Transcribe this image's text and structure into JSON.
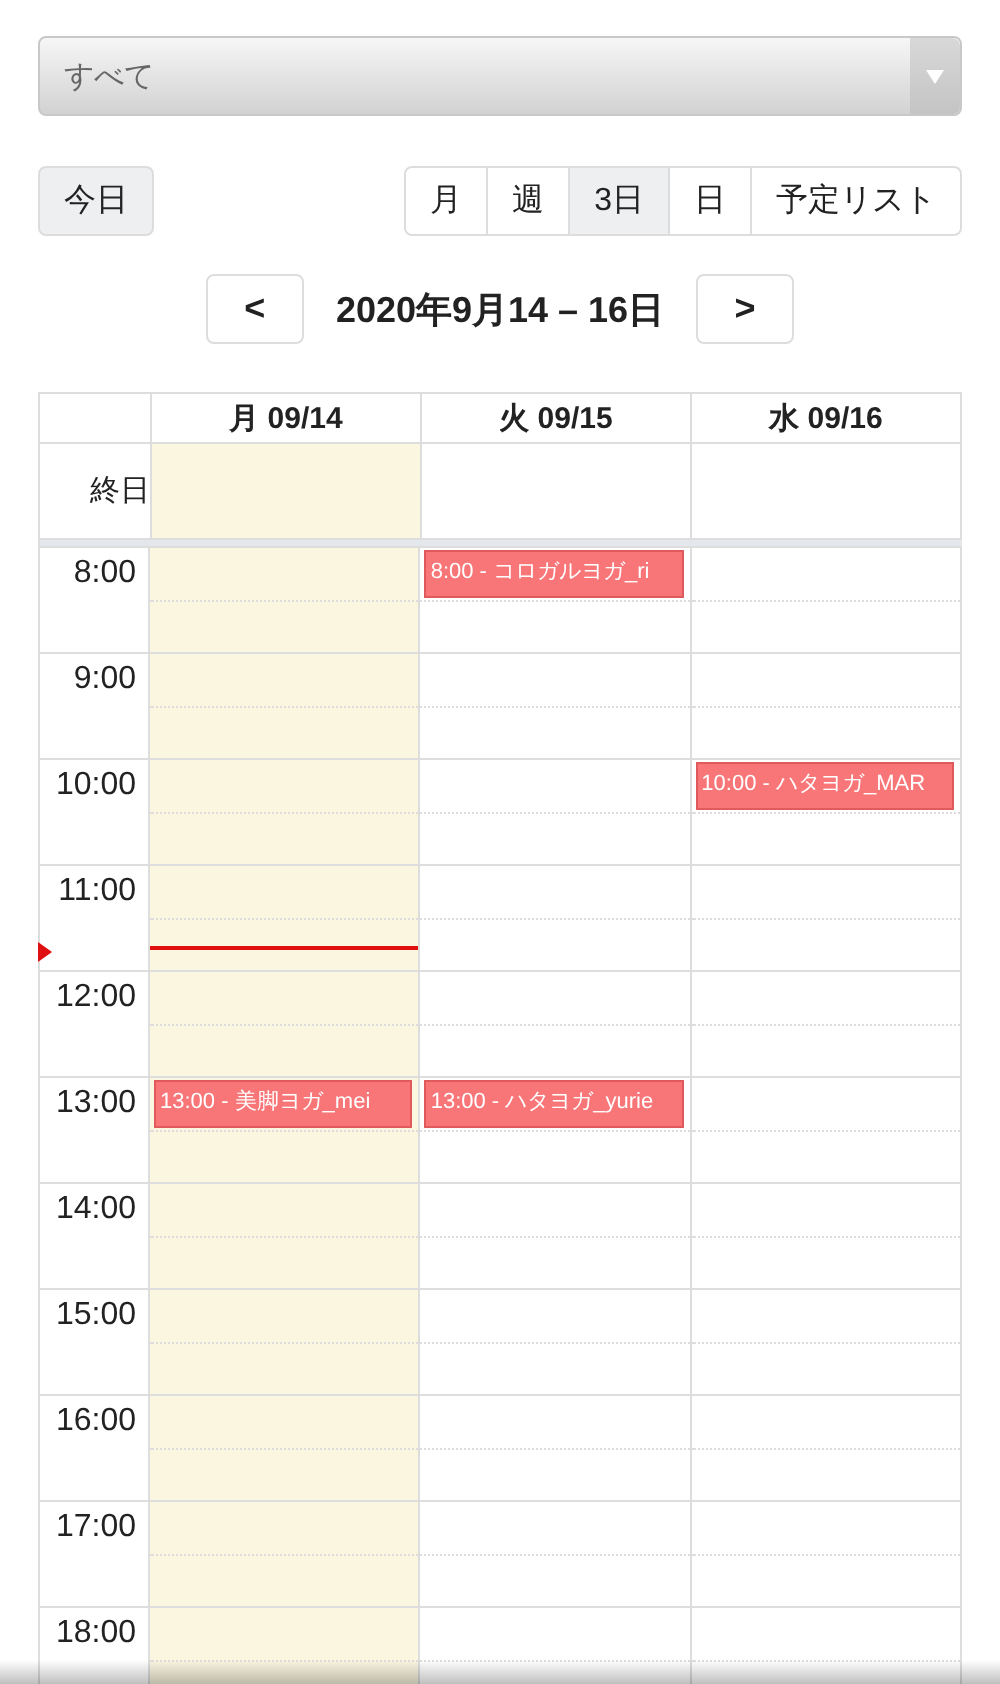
{
  "filter": {
    "value": "すべて"
  },
  "today_button": "今日",
  "views": [
    {
      "label": "月",
      "selected": false
    },
    {
      "label": "週",
      "selected": false
    },
    {
      "label": "3日",
      "selected": true
    },
    {
      "label": "日",
      "selected": false
    },
    {
      "label": "予定リスト",
      "selected": false
    }
  ],
  "nav": {
    "prev": "<",
    "title": "2020年9月14 – 16日",
    "next": ">"
  },
  "days": [
    {
      "label": "月 09/14",
      "today": true
    },
    {
      "label": "火 09/15",
      "today": false
    },
    {
      "label": "水 09/16",
      "today": false
    }
  ],
  "all_day_label": "終日",
  "hours": [
    {
      "label": "8:00",
      "cells": [
        {},
        {
          "event": "8:00 - コロガルヨガ_ri"
        },
        {}
      ]
    },
    {
      "label": "9:00",
      "cells": [
        {},
        {},
        {}
      ]
    },
    {
      "label": "10:00",
      "cells": [
        {},
        {},
        {
          "event": "10:00 - ハタヨガ_MAR"
        }
      ]
    },
    {
      "label": "11:00",
      "cells": [
        {},
        {},
        {}
      ]
    },
    {
      "label": "12:00",
      "cells": [
        {},
        {},
        {}
      ]
    },
    {
      "label": "13:00",
      "cells": [
        {
          "event": "13:00 - 美脚ヨガ_mei"
        },
        {
          "event": "13:00 - ハタヨガ_yurie"
        },
        {}
      ]
    },
    {
      "label": "14:00",
      "cells": [
        {},
        {},
        {}
      ]
    },
    {
      "label": "15:00",
      "cells": [
        {},
        {},
        {}
      ]
    },
    {
      "label": "16:00",
      "cells": [
        {},
        {},
        {}
      ]
    },
    {
      "label": "17:00",
      "cells": [
        {},
        {},
        {}
      ]
    },
    {
      "label": "18:00",
      "cells": [
        {},
        {},
        {}
      ]
    }
  ]
}
